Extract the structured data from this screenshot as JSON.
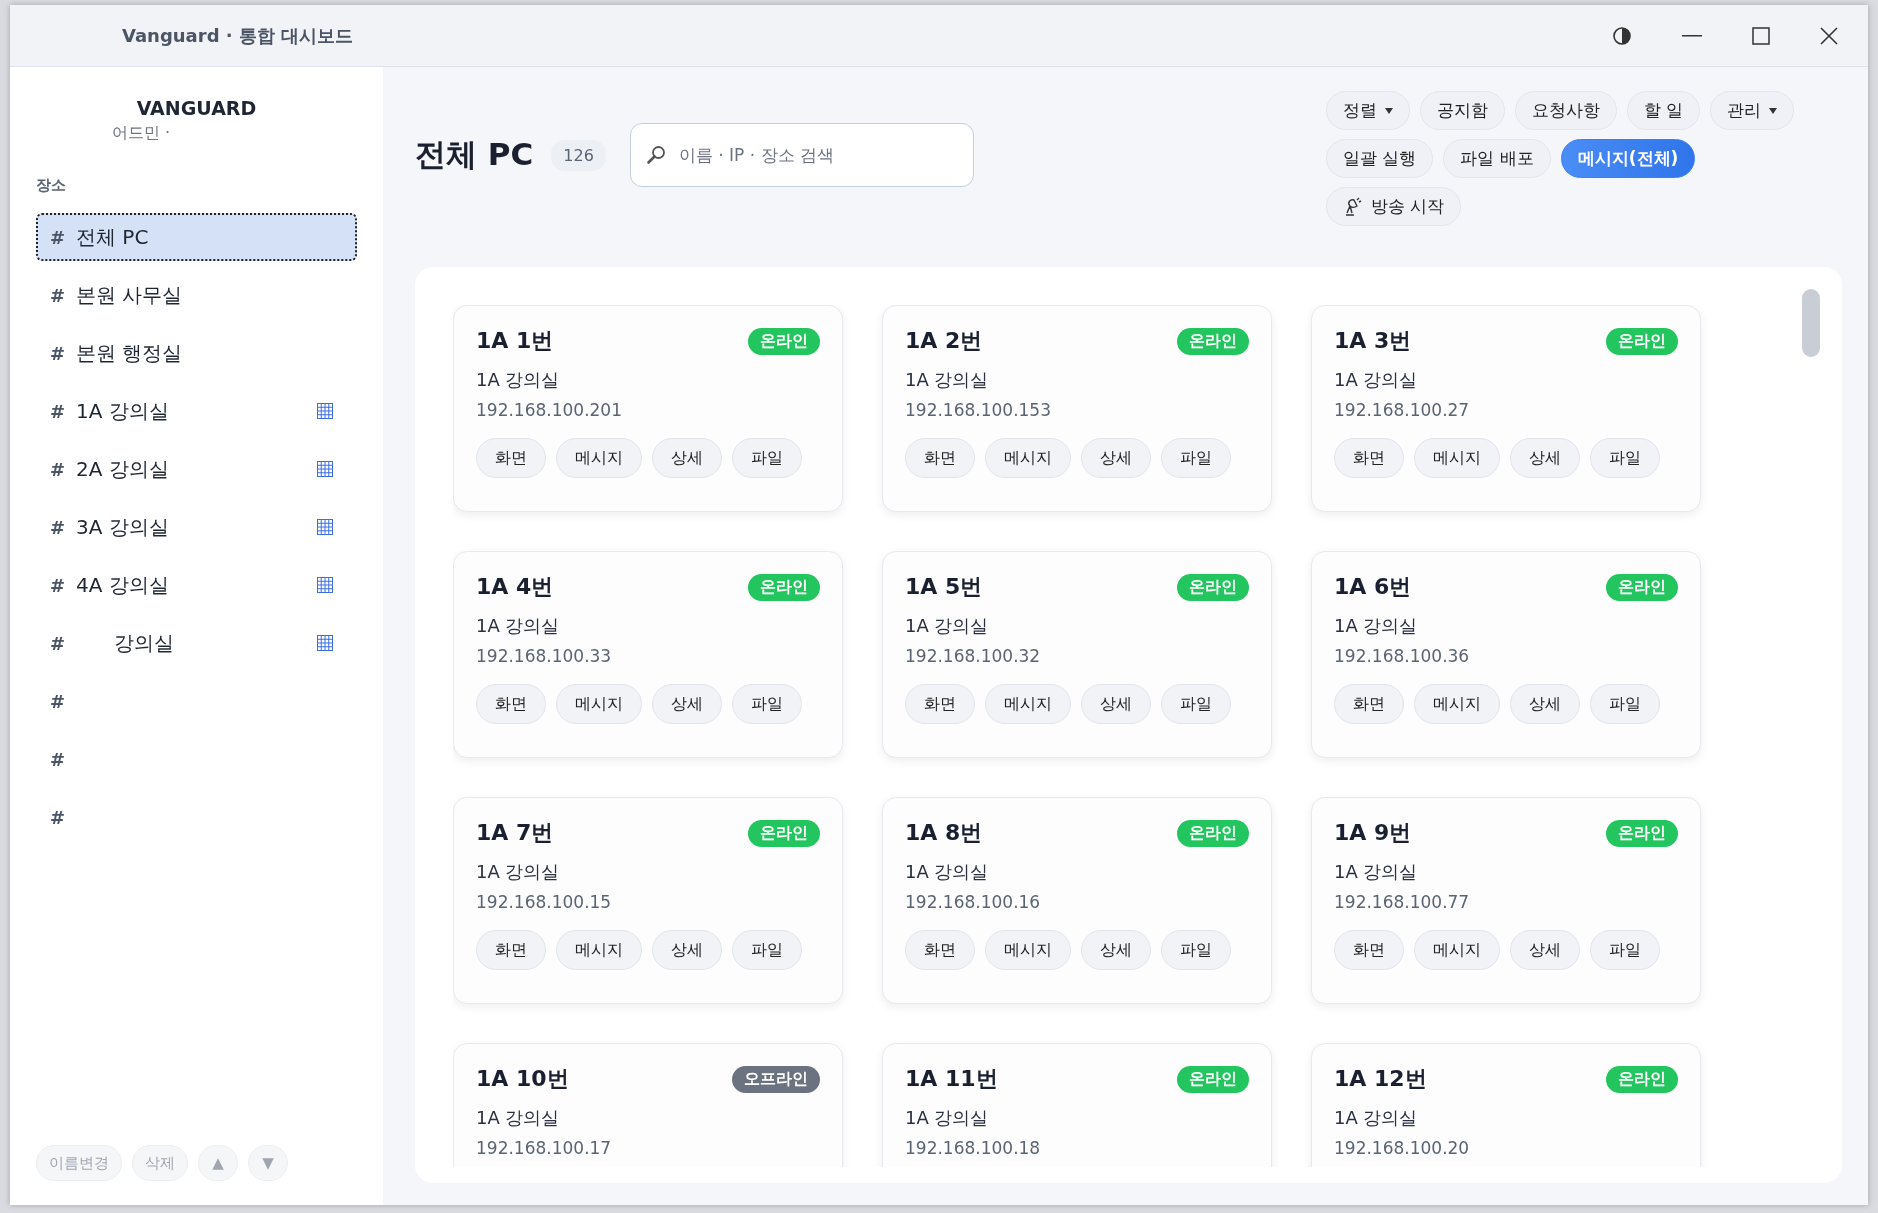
{
  "window": {
    "title": "Vanguard · 통합 대시보드"
  },
  "sidebar": {
    "brand": "VANGUARD",
    "user": "어드민 ·",
    "section": "장소",
    "hash": "#",
    "items": [
      {
        "name": "전체 PC",
        "grid": false,
        "selected": true
      },
      {
        "name": "본원 사무실",
        "grid": false,
        "selected": false
      },
      {
        "name": "본원 행정실",
        "grid": false,
        "selected": false
      },
      {
        "name": "1A 강의실",
        "grid": true,
        "selected": false
      },
      {
        "name": "2A 강의실",
        "grid": true,
        "selected": false
      },
      {
        "name": "3A 강의실",
        "grid": true,
        "selected": false
      },
      {
        "name": "4A 강의실",
        "grid": true,
        "selected": false
      },
      {
        "name": "강의실",
        "grid": true,
        "selected": false,
        "indent": true
      },
      {
        "grid": false,
        "selected": false
      },
      {
        "grid": false,
        "selected": false
      },
      {
        "grid": false,
        "selected": false
      }
    ],
    "footer_buttons": [
      {
        "label": "이름변경",
        "disabled": true
      },
      {
        "label": "삭제",
        "disabled": true
      },
      {
        "label": "▲",
        "disabled": true
      },
      {
        "label": "▼",
        "disabled": true
      }
    ]
  },
  "header": {
    "title": "전체 PC",
    "count": "126",
    "search": {
      "placeholder": "이름 · IP · 장소 검색"
    }
  },
  "toolbar": [
    [
      {
        "label": "정렬",
        "kind": "dropdown",
        "selected": false
      },
      {
        "label": "공지함",
        "kind": "plain",
        "selected": false
      },
      {
        "label": "요청사항",
        "kind": "plain",
        "selected": false
      },
      {
        "label": "할 일",
        "kind": "plain",
        "selected": false
      },
      {
        "label": "관리",
        "kind": "dropdown",
        "selected": false
      }
    ],
    [
      {
        "label": "일괄 실행",
        "kind": "plain",
        "selected": false
      },
      {
        "label": "파일 배포",
        "kind": "plain",
        "selected": false
      },
      {
        "label": "메시지(전체)",
        "kind": "plain",
        "selected": true
      }
    ],
    [
      {
        "label": "방송 시작",
        "kind": "broadcast",
        "selected": false
      }
    ]
  ],
  "cards": [
    {
      "name": "1A 1번",
      "status": "온라인",
      "color": "#22c55e",
      "location": "1A 강의실",
      "ip": "192.168.100.201",
      "buttons": [
        "화면",
        "메시지",
        "상세",
        "파일"
      ]
    },
    {
      "name": "1A 2번",
      "status": "온라인",
      "color": "#22c55e",
      "location": "1A 강의실",
      "ip": "192.168.100.153",
      "buttons": [
        "화면",
        "메시지",
        "상세",
        "파일"
      ]
    },
    {
      "name": "1A 3번",
      "status": "온라인",
      "color": "#22c55e",
      "location": "1A 강의실",
      "ip": "192.168.100.27",
      "buttons": [
        "화면",
        "메시지",
        "상세",
        "파일"
      ]
    },
    {
      "name": "1A 4번",
      "status": "온라인",
      "color": "#22c55e",
      "location": "1A 강의실",
      "ip": "192.168.100.33",
      "buttons": [
        "화면",
        "메시지",
        "상세",
        "파일"
      ]
    },
    {
      "name": "1A 5번",
      "status": "온라인",
      "color": "#22c55e",
      "location": "1A 강의실",
      "ip": "192.168.100.32",
      "buttons": [
        "화면",
        "메시지",
        "상세",
        "파일"
      ]
    },
    {
      "name": "1A 6번",
      "status": "온라인",
      "color": "#22c55e",
      "location": "1A 강의실",
      "ip": "192.168.100.36",
      "buttons": [
        "화면",
        "메시지",
        "상세",
        "파일"
      ]
    },
    {
      "name": "1A 7번",
      "status": "온라인",
      "color": "#22c55e",
      "location": "1A 강의실",
      "ip": "192.168.100.15",
      "buttons": [
        "화면",
        "메시지",
        "상세",
        "파일"
      ]
    },
    {
      "name": "1A 8번",
      "status": "온라인",
      "color": "#22c55e",
      "location": "1A 강의실",
      "ip": "192.168.100.16",
      "buttons": [
        "화면",
        "메시지",
        "상세",
        "파일"
      ]
    },
    {
      "name": "1A 9번",
      "status": "온라인",
      "color": "#22c55e",
      "location": "1A 강의실",
      "ip": "192.168.100.77",
      "buttons": [
        "화면",
        "메시지",
        "상세",
        "파일"
      ]
    },
    {
      "name": "1A 10번",
      "status": "오프라인",
      "color": "#6b7280",
      "location": "1A 강의실",
      "ip": "192.168.100.17"
    },
    {
      "name": "1A 11번",
      "status": "온라인",
      "color": "#22c55e",
      "location": "1A 강의실",
      "ip": "192.168.100.18"
    },
    {
      "name": "1A 12번",
      "status": "온라인",
      "color": "#22c55e",
      "location": "1A 강의실",
      "ip": "192.168.100.20"
    }
  ]
}
